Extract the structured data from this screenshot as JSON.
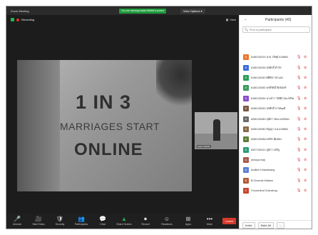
{
  "window": {
    "title": "Zoom Meeting"
  },
  "share_banner": "You are viewing Kakai WAWA's screen",
  "view_options": "View Options",
  "recording": "Recording",
  "view_button": "View",
  "slide": {
    "line1": "1 IN 3",
    "line2": "MARRIAGES START",
    "line3": "ONLINE"
  },
  "thumbnail_label": "Kakai WAWA",
  "toolbar": [
    {
      "name": "unmute",
      "label": "Unmute",
      "icon": "🎤"
    },
    {
      "name": "start-video",
      "label": "Start Video",
      "icon": "🎥"
    },
    {
      "name": "security",
      "label": "Security",
      "icon": "🛡"
    },
    {
      "name": "participants",
      "label": "Participants",
      "icon": "👥"
    },
    {
      "name": "chat",
      "label": "Chat",
      "icon": "💬"
    },
    {
      "name": "share-screen",
      "label": "Share Screen",
      "icon": "▲"
    },
    {
      "name": "record",
      "label": "Record",
      "icon": "⏺"
    },
    {
      "name": "reactions",
      "label": "Reactions",
      "icon": "☺"
    },
    {
      "name": "apps",
      "label": "Apps",
      "icon": "⊞"
    },
    {
      "name": "more",
      "label": "More",
      "icon": "•••"
    }
  ],
  "end_button": "Leave",
  "participants_panel": {
    "title": "Participants (40)",
    "search_placeholder": "Find a participant",
    "participants": [
      {
        "name": "6180133024 นาย วสิษฐ์ แสงทอง",
        "initial": "6",
        "color": "#e8772e"
      },
      {
        "name": "6180133035 สุรศักดิ์ ดำรัส",
        "initial": "6",
        "color": "#3b6fd9"
      },
      {
        "name": "6180133040 ศศิธิดา ค่าแลง",
        "initial": "6",
        "color": "#2aa157"
      },
      {
        "name": "6180133050 พรธิรัศมิ์ จิตจันทร์",
        "initial": "6",
        "color": "#3a9b5c"
      },
      {
        "name": "6180133054 นางสาว วิศนีย์ ธนะทรัพย์",
        "initial": "6",
        "color": "#8a4fc9"
      },
      {
        "name": "6280133052 สุรศักดิ์ การพัฒนี",
        "initial": "6",
        "color": "#7a5a44"
      },
      {
        "name": "6280133080 ปุณิกา ทอน แสงทอง",
        "initial": "6",
        "color": "#6b6b6b"
      },
      {
        "name": "6280133080 ธัญญา แน่ แสงทอง",
        "initial": "6",
        "color": "#8b6a4a"
      },
      {
        "name": "6280133086 ผลกิต หุ้มทอง",
        "initial": "6",
        "color": "#5f7d3a"
      },
      {
        "name": "6307133013 ภูมิกา เจริญ",
        "initial": "6",
        "color": "#2a9c7a"
      },
      {
        "name": "annuya maji",
        "initial": "a",
        "color": "#a8594c"
      },
      {
        "name": "Auditch Khamduang",
        "initial": "A",
        "color": "#5a7fd8"
      },
      {
        "name": "B.Chonrak Kaltaon",
        "initial": "B",
        "color": "#b35a36"
      },
      {
        "name": "Chonchinot Chandung",
        "initial": "C",
        "color": "#c7452f"
      }
    ],
    "invite_button": "Invite",
    "mute_all_button": "Mute All",
    "more_button": "..."
  },
  "colors": {
    "share_green": "#1e9c3c",
    "end_red": "#d73a2e",
    "muted_red": "#d9363e"
  }
}
